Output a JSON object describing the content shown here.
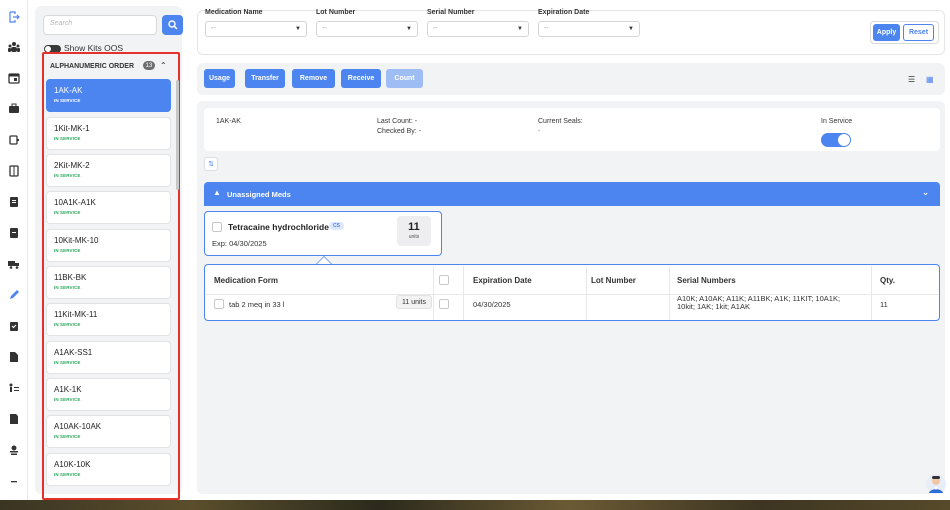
{
  "rail": {
    "icons": [
      "logout-icon",
      "users-icon",
      "calendar-icon",
      "kits-icon",
      "device-icon",
      "storage-icon",
      "report-icon",
      "document-icon",
      "truck-icon",
      "edit-icon",
      "clipboard-icon",
      "file-icon",
      "list-icon",
      "receipt-icon",
      "ribbon-icon",
      "more-icon"
    ]
  },
  "sidebar": {
    "search_placeholder": "Search",
    "show_kits_label": "Show Kits OOS",
    "order_label": "ALPHANUMERIC ORDER",
    "order_count": "13",
    "kits": [
      {
        "name": "1AK-AK",
        "status": "IN SERVICE"
      },
      {
        "name": "1Kit-MK-1",
        "status": "IN SERVICE"
      },
      {
        "name": "2Kit-MK-2",
        "status": "IN SERVICE"
      },
      {
        "name": "10A1K-A1K",
        "status": "IN SERVICE"
      },
      {
        "name": "10Kit-MK-10",
        "status": "IN SERVICE"
      },
      {
        "name": "11BK-BK",
        "status": "IN SERVICE"
      },
      {
        "name": "11Kit-MK-11",
        "status": "IN SERVICE"
      },
      {
        "name": "A1AK-SS1",
        "status": "IN SERVICE"
      },
      {
        "name": "A1K-1K",
        "status": "IN SERVICE"
      },
      {
        "name": "A10AK-10AK",
        "status": "IN SERVICE"
      },
      {
        "name": "A10K-10K",
        "status": "IN SERVICE"
      }
    ]
  },
  "filters": {
    "medication_name": {
      "label": "Medication Name",
      "value": "--"
    },
    "lot_number": {
      "label": "Lot Number",
      "value": "--"
    },
    "serial_number": {
      "label": "Serial Number",
      "value": "--"
    },
    "expiration_date": {
      "label": "Expiration Date",
      "value": "--"
    },
    "apply": "Apply",
    "reset": "Reset"
  },
  "toolbar": {
    "usage": "Usage",
    "transfer": "Transfer",
    "remove": "Remove",
    "receive": "Receive",
    "count": "Count"
  },
  "kit_detail": {
    "name": "1AK-AK",
    "last_count": "Last Count: -",
    "checked_by": "Checked By: -",
    "current_seals_label": "Current Seals:",
    "current_seals_value": "-",
    "in_service_label": "In Service",
    "in_service": true
  },
  "unassigned": {
    "title": "Unassigned Meds",
    "medication": {
      "name": "Tetracaine hydrochloride",
      "badge": "CS",
      "expiry": "Exp: 04/30/2025",
      "qty": "11",
      "qty_unit": "units"
    },
    "table": {
      "headers": {
        "form": "Medication Form",
        "expiration": "Expiration Date",
        "lot": "Lot Number",
        "serials": "Serial Numbers",
        "qty": "Qty."
      },
      "row": {
        "form": "tab 2 meq in 33 l",
        "units": "11 units",
        "expiration": "04/30/2025",
        "lot": "",
        "serials_line1": "A10K; A10AK; A11K; A11BK; A1K; 11KIT; 10A1K;",
        "serials_line2": "10kit; 1AK; 1kit; A1AK",
        "qty": "11"
      }
    }
  },
  "colors": {
    "accent": "#4c84f0",
    "success": "#2ca55b",
    "highlight_border": "#e4322b"
  }
}
